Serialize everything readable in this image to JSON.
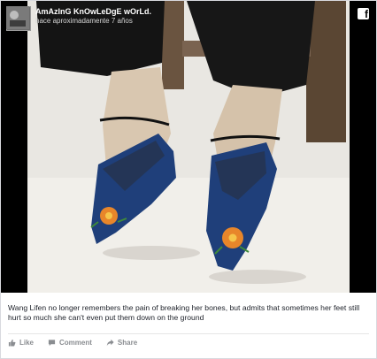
{
  "post": {
    "page_name": "AmAzInG KnOwLeDgE wOrLd.",
    "time": "hace aproximadamente 7 años",
    "caption": "Wang Lifen no longer remembers the pain of breaking her bones, but admits that sometimes her feet still hurt so much she can't even put them down on the ground"
  },
  "icons": {
    "brand": "facebook-icon",
    "like": "thumb-up-icon",
    "comment": "comment-bubble-icon",
    "share": "share-arrow-icon"
  },
  "actions": {
    "like_label": "Like",
    "comment_label": "Comment",
    "share_label": "Share"
  },
  "colors": {
    "media_bg": "#000000",
    "text": "#1d2129",
    "muted": "#8a8d91",
    "shoe": "#1f3f7a",
    "flower": "#e8862a"
  }
}
